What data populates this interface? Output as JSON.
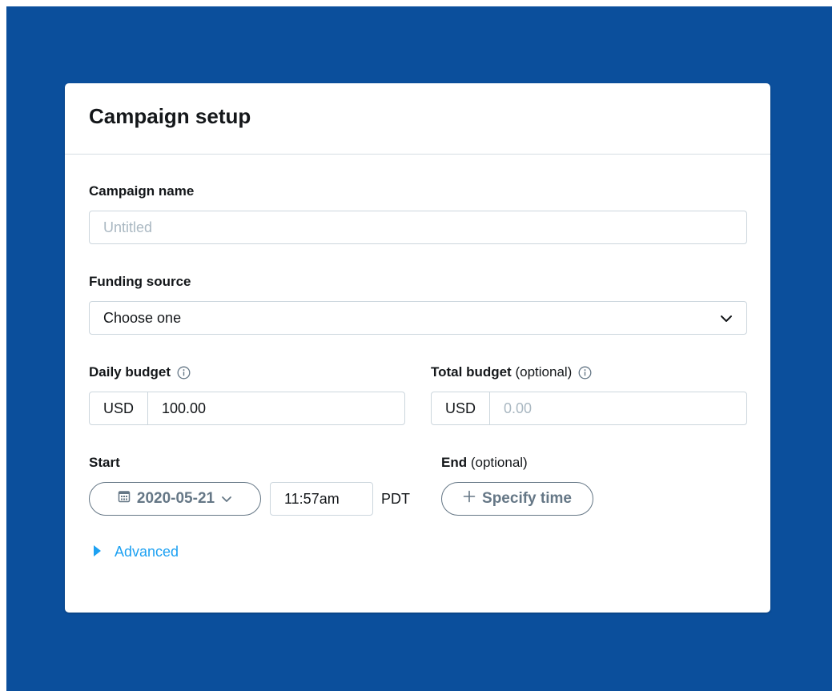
{
  "form": {
    "title": "Campaign setup",
    "campaign_name": {
      "label": "Campaign name",
      "placeholder": "Untitled"
    },
    "funding_source": {
      "label": "Funding source",
      "selected": "Choose one"
    },
    "daily_budget": {
      "label": "Daily budget",
      "currency": "USD",
      "value": "100.00"
    },
    "total_budget": {
      "label": "Total budget",
      "optional": "(optional)",
      "currency": "USD",
      "placeholder": "0.00"
    },
    "start": {
      "label": "Start",
      "date": "2020-05-21",
      "time": "11:57am",
      "timezone": "PDT"
    },
    "end": {
      "label": "End",
      "optional": "(optional)",
      "button_label": "Specify time"
    },
    "advanced_label": "Advanced"
  },
  "icons": {
    "info": "info-icon",
    "chevron": "chevron-down-icon",
    "calendar": "calendar-icon",
    "plus": "plus-icon",
    "disclosure": "caret-right-icon"
  },
  "colors": {
    "backdrop": "#0b4f9c",
    "link": "#1da1f2",
    "pill_text": "#657786",
    "border": "#ccd6dd"
  }
}
